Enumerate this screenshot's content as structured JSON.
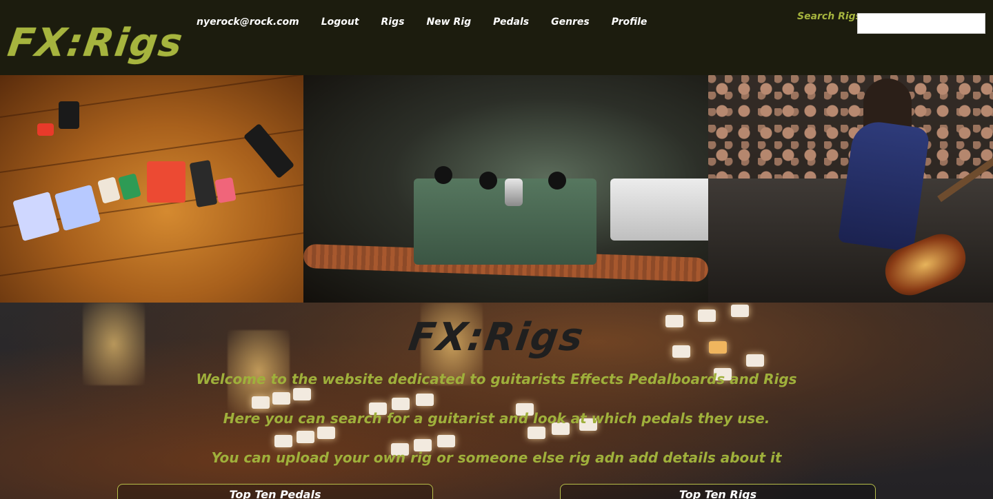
{
  "header": {
    "logo_text": "FX:Rigs",
    "nav": {
      "user_email": "nyerock@rock.com",
      "logout": "Logout",
      "rigs": "Rigs",
      "new_rig": "New Rig",
      "pedals": "Pedals",
      "genres": "Genres",
      "profile": "Profile"
    },
    "search": {
      "label": "Search Rigs:",
      "value": "",
      "placeholder": ""
    }
  },
  "hero_images": [
    {
      "name": "pedalboard-floor-photo"
    },
    {
      "name": "green-pedal-closeup-photo"
    },
    {
      "name": "guitarist-on-stage-photo"
    }
  ],
  "main": {
    "title": "FX:Rigs",
    "taglines": [
      "Welcome to the website dedicated to guitarists Effects Pedalboards and Rigs",
      "Here you can search for a guitarist and look at which pedals they use.",
      "You can upload your own rig or someone else rig adn add details about it"
    ],
    "panels": {
      "left_title": "Top Ten Pedals",
      "right_title": "Top Ten Rigs"
    }
  },
  "colors": {
    "accent_green": "#a6b43e",
    "header_bg": "#1c1c0e"
  }
}
